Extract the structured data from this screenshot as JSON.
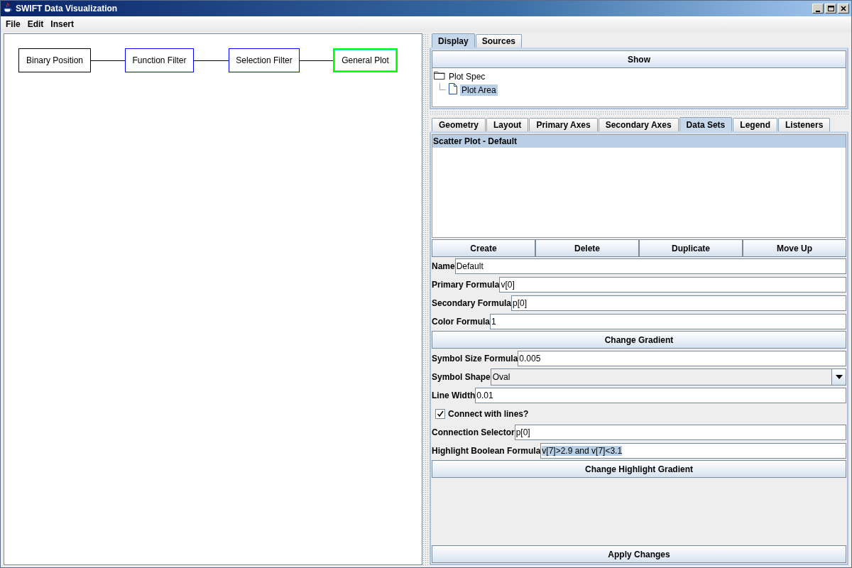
{
  "window": {
    "title": "SWIFT Data Visualization"
  },
  "menu": [
    "File",
    "Edit",
    "Insert"
  ],
  "diagram": {
    "nodes": [
      {
        "label": "Binary Position",
        "color": "#000000",
        "selected": false
      },
      {
        "label": "Function Filter",
        "color": "#0000ff",
        "selected": false
      },
      {
        "label": "Selection Filter",
        "color": "#0000ff",
        "selected": false
      },
      {
        "label": "General Plot",
        "color": "#00ff00",
        "selected": true
      }
    ]
  },
  "top_tabs": [
    {
      "label": "Display",
      "selected": true
    },
    {
      "label": "Sources",
      "selected": false
    }
  ],
  "show_button": "Show",
  "tree": {
    "label": "Plot Spec",
    "selected": false,
    "children": [
      {
        "label": "Plot Area",
        "selected": true
      }
    ]
  },
  "tabs": [
    {
      "label": "Geometry",
      "selected": false
    },
    {
      "label": "Layout",
      "selected": false
    },
    {
      "label": "Primary Axes",
      "selected": false
    },
    {
      "label": "Secondary Axes",
      "selected": false
    },
    {
      "label": "Data Sets",
      "selected": true
    },
    {
      "label": "Legend",
      "selected": false
    },
    {
      "label": "Listeners",
      "selected": false
    }
  ],
  "data_sets": [
    {
      "label": "Scatter Plot - Default",
      "selected": true
    }
  ],
  "list_buttons": [
    "Create",
    "Delete",
    "Duplicate",
    "Move Up"
  ],
  "form": [
    {
      "kind": "text",
      "label": "Name",
      "value": "Default"
    },
    {
      "kind": "text",
      "label": "Primary Formula",
      "value": "v[0]"
    },
    {
      "kind": "text",
      "label": "Secondary Formula",
      "value": "p[0]"
    },
    {
      "kind": "text",
      "label": "Color Formula",
      "value": "1"
    },
    {
      "kind": "button",
      "label": "Change Gradient"
    },
    {
      "kind": "text",
      "label": "Symbol Size Formula",
      "value": "0.005"
    },
    {
      "kind": "select",
      "label": "Symbol Shape",
      "value": "Oval"
    },
    {
      "kind": "text",
      "label": "Line Width",
      "value": "0.01"
    },
    {
      "kind": "checkbox",
      "label": "Connect with lines?",
      "checked": true
    },
    {
      "kind": "text",
      "label": "Connection Selector",
      "value": "p[0]"
    },
    {
      "kind": "text",
      "label": "Highlight Boolean Formula",
      "value": "v[7]>2.9 and v[7]<3.1",
      "highlighted": true
    },
    {
      "kind": "button",
      "label": "Change Highlight Gradient"
    }
  ],
  "apply_button": "Apply Changes"
}
